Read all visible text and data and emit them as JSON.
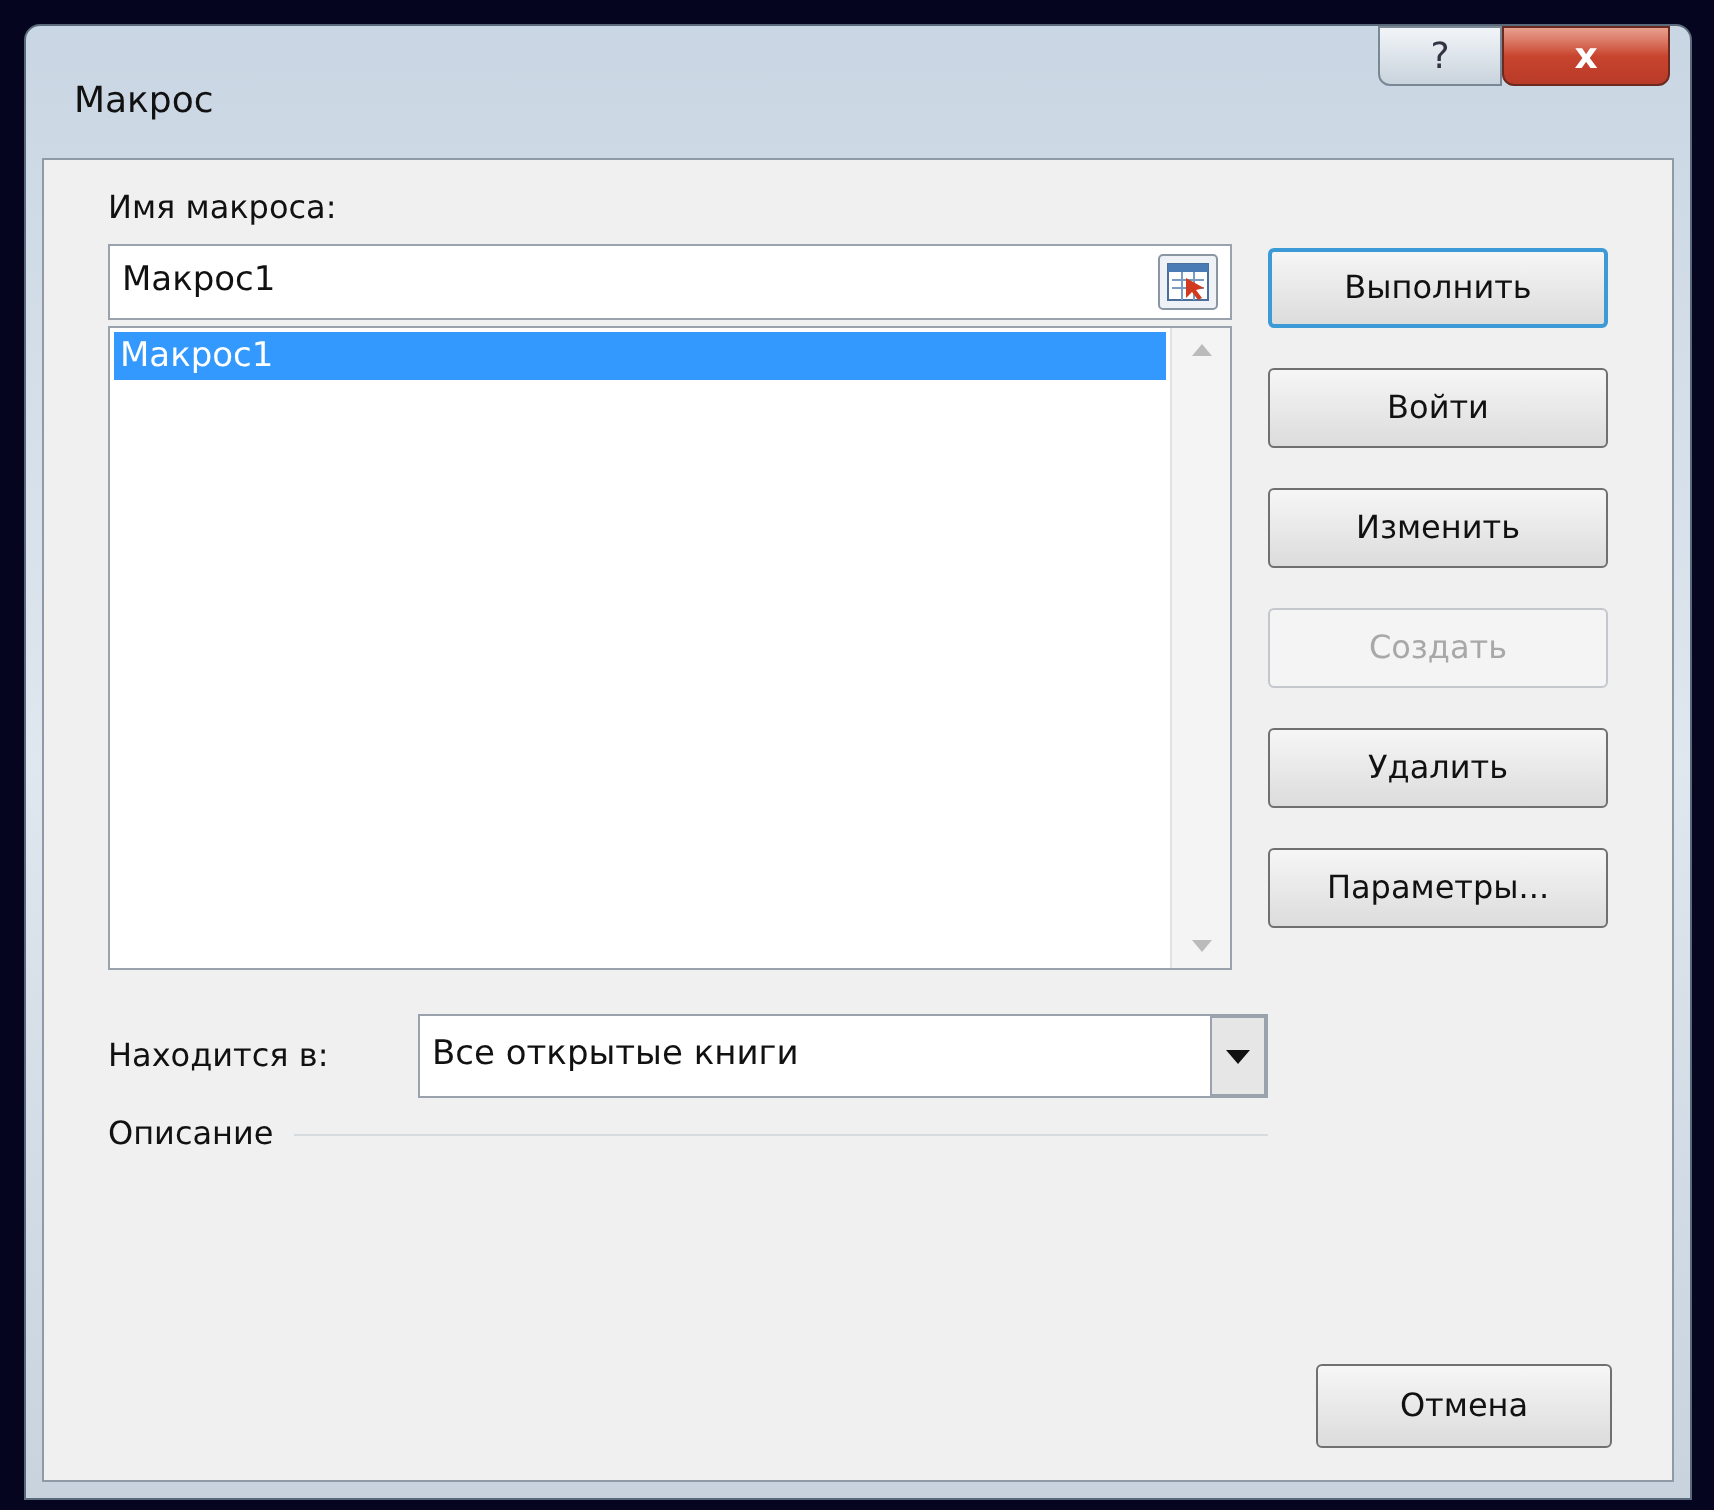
{
  "window": {
    "title": "Макрос",
    "title_buttons": [
      {
        "kind": "help",
        "label": "?"
      },
      {
        "kind": "close",
        "label": "x"
      }
    ]
  },
  "macro_name": {
    "label": "Имя макроса:",
    "value": "Макрос1"
  },
  "macro_list": [
    {
      "name": "Макрос1",
      "selected": true
    }
  ],
  "buttons": [
    {
      "label": "Выполнить",
      "default": true,
      "disabled": false
    },
    {
      "label": "Войти",
      "default": false,
      "disabled": false
    },
    {
      "label": "Изменить",
      "default": false,
      "disabled": false
    },
    {
      "label": "Создать",
      "default": false,
      "disabled": true
    },
    {
      "label": "Удалить",
      "default": false,
      "disabled": false
    },
    {
      "label": "Параметры...",
      "default": false,
      "disabled": false
    }
  ],
  "location": {
    "label": "Находится в:",
    "value": "Все открытые книги"
  },
  "description": {
    "label": "Описание"
  },
  "cancel_button": {
    "label": "Отмена"
  }
}
